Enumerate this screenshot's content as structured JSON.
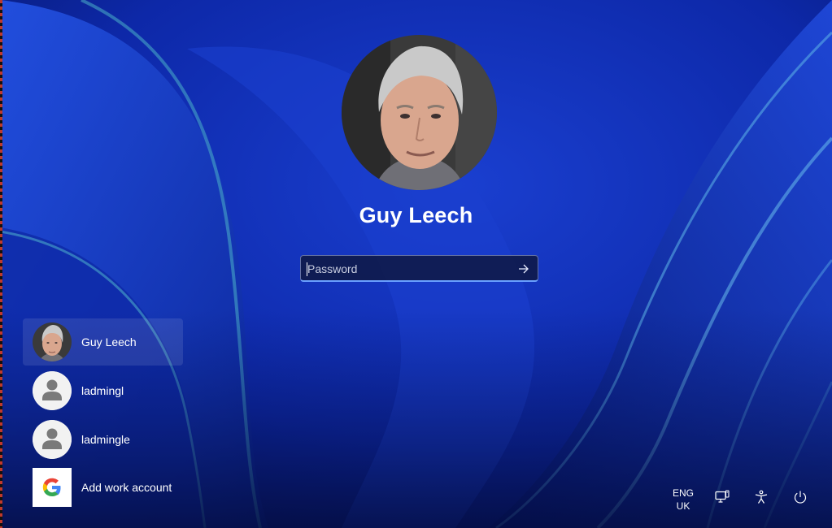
{
  "lock_screen": {
    "user_name": "Guy Leech",
    "password_placeholder": "Password",
    "submit_icon": "arrow-right-icon"
  },
  "user_list": [
    {
      "label": "Guy Leech",
      "avatar": "photo",
      "selected": true
    },
    {
      "label": "ladmingl",
      "avatar": "generic-user-icon",
      "selected": false
    },
    {
      "label": "ladmingle",
      "avatar": "generic-user-icon",
      "selected": false
    },
    {
      "label": "Add work account",
      "avatar": "google-icon",
      "selected": false
    }
  ],
  "tray": {
    "language_line1": "ENG",
    "language_line2": "UK",
    "icons": [
      "network-icon",
      "accessibility-icon",
      "power-icon"
    ]
  },
  "colors": {
    "background": "#0a1e8a",
    "accent": "#6aa0ff"
  }
}
